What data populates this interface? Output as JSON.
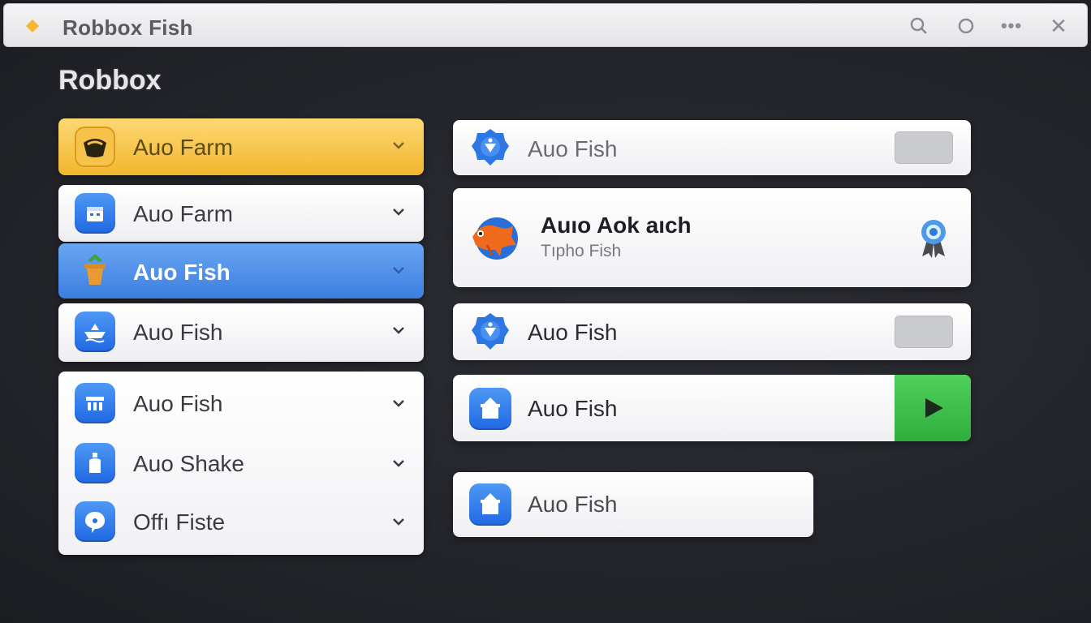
{
  "window": {
    "title": "Robbox Fish",
    "controls": [
      "search-icon",
      "circle-icon",
      "more-icon",
      "close-icon"
    ],
    "more_glyph": "•••",
    "close_glyph": "✕"
  },
  "heading": "Robbox",
  "left_menu": {
    "items": [
      {
        "label": "Auo Farm",
        "icon": "fish-bowl-icon",
        "state": "highlighted-yellow"
      },
      {
        "label": "Auo Farm",
        "icon": "calendar-icon",
        "state": "normal"
      },
      {
        "label": "Auo Fish",
        "icon": "plant-pot-icon",
        "state": "selected-blue"
      },
      {
        "label": "Auo Fish",
        "icon": "boat-icon",
        "state": "normal"
      }
    ],
    "group": [
      {
        "label": "Auo Fish",
        "icon": "table-icon"
      },
      {
        "label": "Auo Shake",
        "icon": "bottle-icon"
      },
      {
        "label": "Offı Fiste",
        "icon": "chat-bubble-icon"
      }
    ]
  },
  "right_panel": {
    "card1": {
      "label": "Auo Fish",
      "icon": "shield-badge-icon",
      "toggle": "off"
    },
    "featured": {
      "title": "Auıo Aok aıch",
      "subtitle": "Tıpho Fish",
      "icon": "orange-fish-icon",
      "badge": "award-ribbon-icon"
    },
    "card3": {
      "label": "Auo Fish",
      "icon": "shield-badge-icon",
      "toggle": "off"
    },
    "card4": {
      "label": "Auo Fish",
      "icon": "house-icon",
      "action": "play-icon"
    },
    "card5": {
      "label": "Auo Fish",
      "icon": "house-icon"
    }
  },
  "colors": {
    "background": "#24262c",
    "yellow_accent": "#f2b630",
    "blue_accent": "#3c7fe0",
    "green_play": "#2fae3d"
  }
}
